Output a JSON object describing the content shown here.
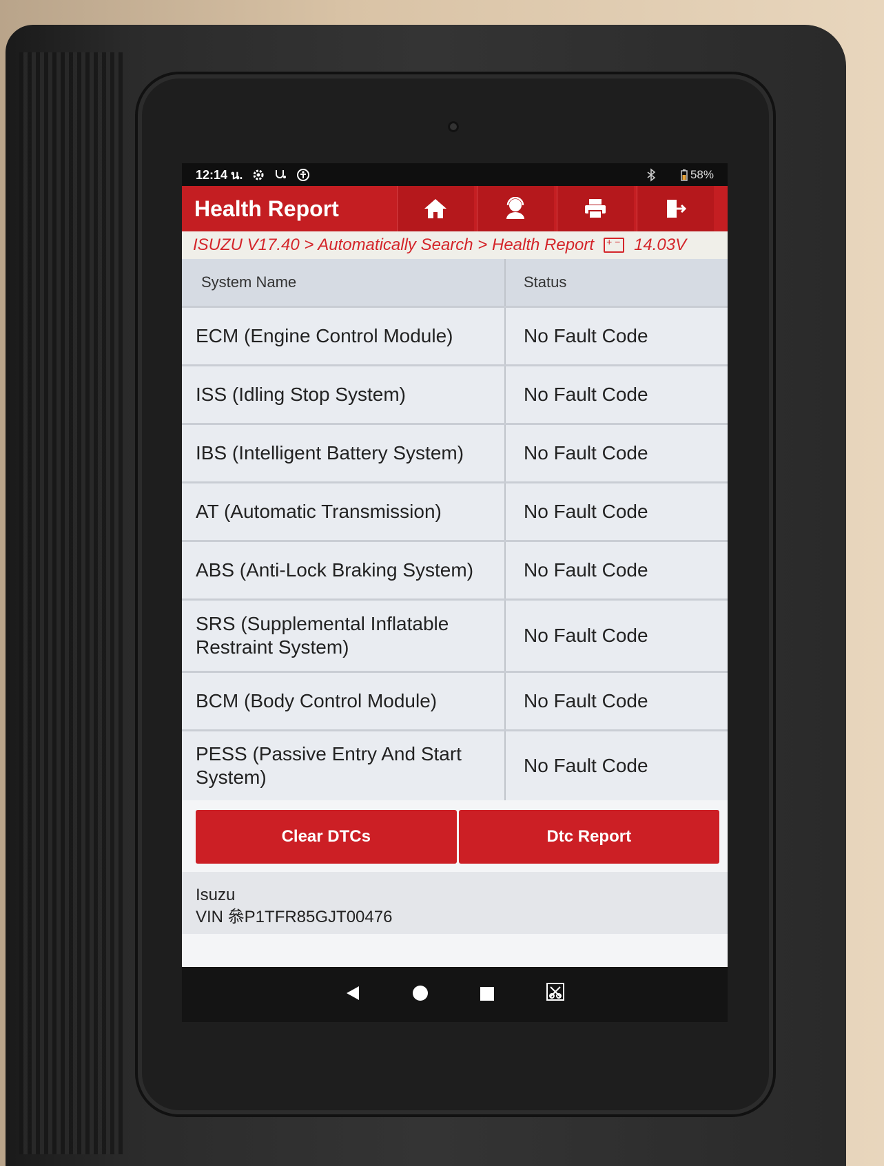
{
  "status_bar": {
    "time": "12:14 น.",
    "icons": [
      "settings-icon",
      "stethoscope-icon",
      "accessibility-icon"
    ],
    "bluetooth_icon": "bluetooth-icon",
    "battery": "58%"
  },
  "app_bar": {
    "title": "Health Report",
    "buttons": [
      "home-icon",
      "support-agent-icon",
      "print-icon",
      "exit-icon"
    ]
  },
  "breadcrumb": {
    "path": "ISUZU V17.40 > Automatically Search > Health Report",
    "voltage": "14.03V"
  },
  "table": {
    "headers": {
      "system": "System Name",
      "status": "Status"
    },
    "rows": [
      {
        "system": "ECM (Engine Control Module)",
        "status": "No Fault Code"
      },
      {
        "system": "ISS (Idling Stop System)",
        "status": "No Fault Code"
      },
      {
        "system": "IBS (Intelligent Battery System)",
        "status": "No Fault Code"
      },
      {
        "system": "AT (Automatic Transmission)",
        "status": "No Fault Code"
      },
      {
        "system": "ABS (Anti-Lock Braking System)",
        "status": "No Fault Code"
      },
      {
        "system": "SRS (Supplemental Inflatable Restraint System)",
        "status": "No Fault Code"
      },
      {
        "system": "BCM (Body Control Module)",
        "status": "No Fault Code"
      },
      {
        "system": "PESS (Passive Entry And Start System)",
        "status": "No Fault Code"
      }
    ]
  },
  "actions": {
    "clear": "Clear DTCs",
    "report": "Dtc Report"
  },
  "vehicle": {
    "make": "Isuzu",
    "vin": "VIN 叅P1TFR85GJT00476"
  },
  "nav_bar": [
    "back-icon",
    "home-circle-icon",
    "recents-icon",
    "screenshot-icon"
  ],
  "colors": {
    "accent": "#c41e22",
    "breadcrumb_text": "#d4252a",
    "row_bg": "#e9ecf1"
  }
}
